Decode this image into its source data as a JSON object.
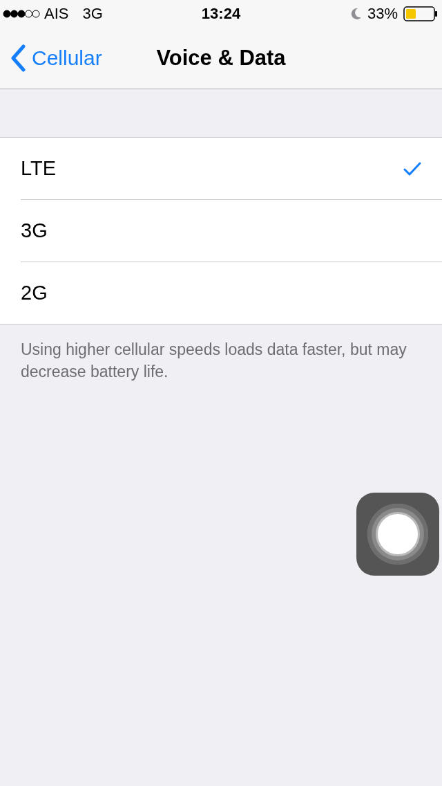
{
  "status_bar": {
    "carrier": "AIS",
    "network": "3G",
    "time": "13:24",
    "battery": "33%"
  },
  "nav": {
    "back": "Cellular",
    "title": "Voice & Data"
  },
  "options": [
    {
      "label": "LTE",
      "selected": true
    },
    {
      "label": "3G",
      "selected": false
    },
    {
      "label": "2G",
      "selected": false
    }
  ],
  "footer": "Using higher cellular speeds loads data faster, but may decrease battery life."
}
